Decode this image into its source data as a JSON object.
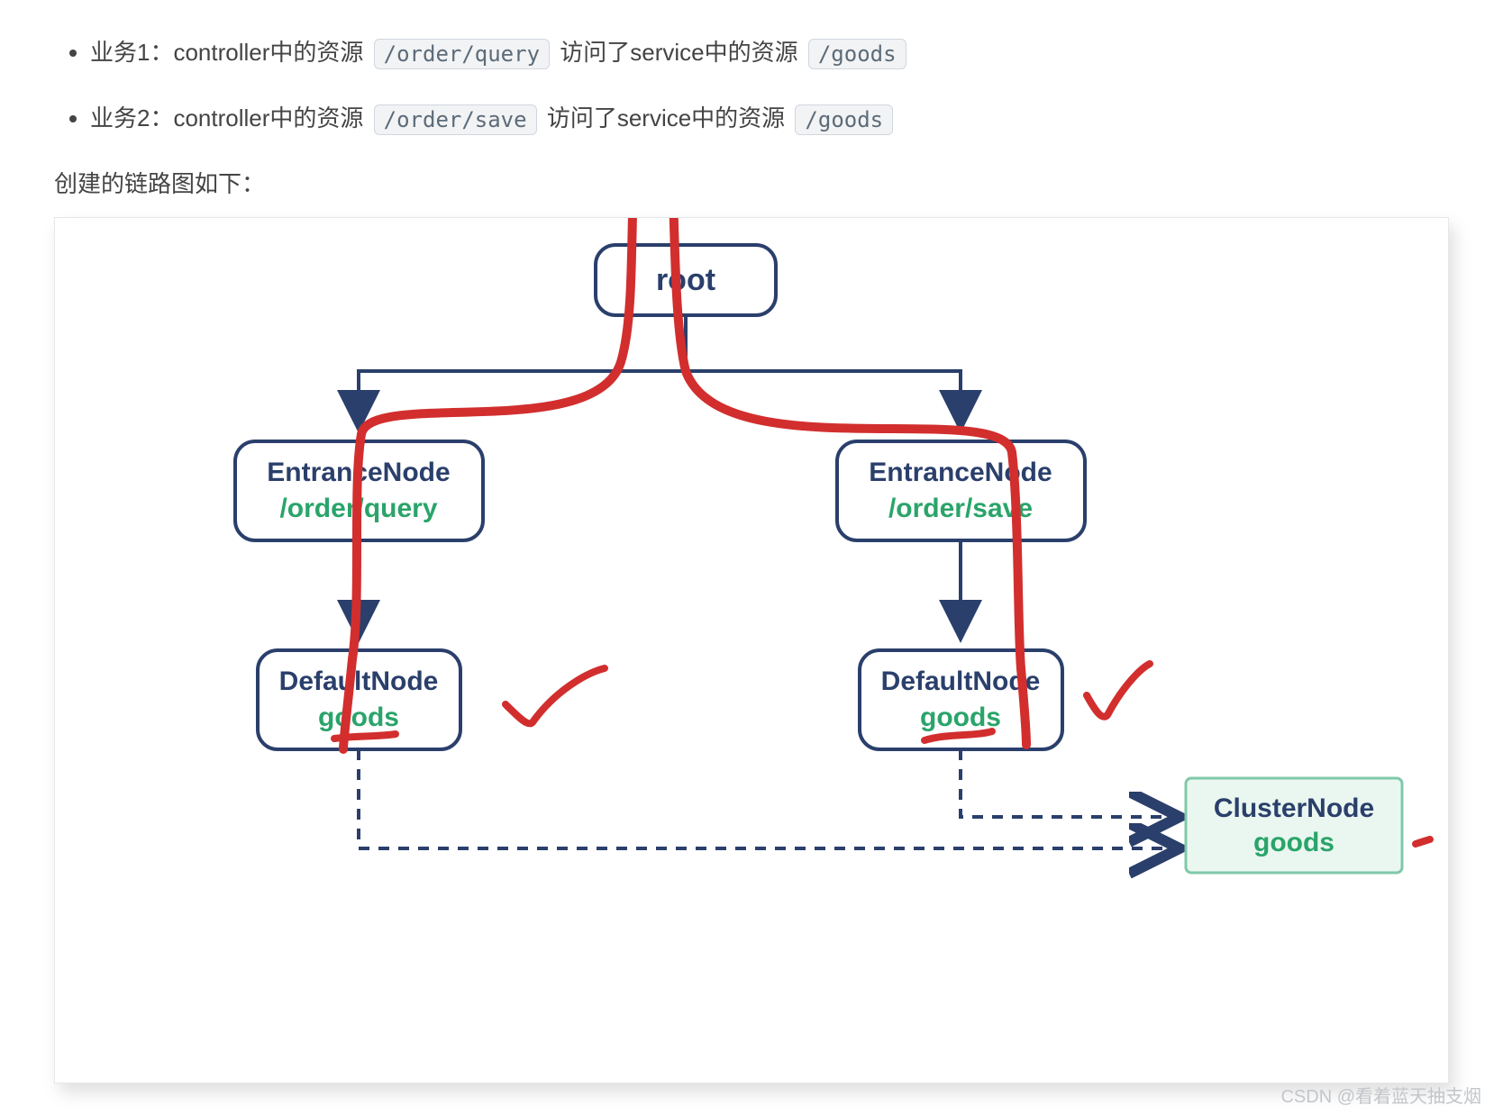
{
  "bullets": [
    {
      "prefix": "业务1：controller中的资源",
      "code1": "/order/query",
      "mid": "访问了service中的资源",
      "code2": "/goods"
    },
    {
      "prefix": "业务2：controller中的资源",
      "code1": "/order/save",
      "mid": "访问了service中的资源",
      "code2": "/goods"
    }
  ],
  "para": "创建的链路图如下：",
  "diagram": {
    "root": "root",
    "entranceLeft": {
      "title": "EntranceNode",
      "path": "/order/query"
    },
    "entranceRight": {
      "title": "EntranceNode",
      "path": "/order/save"
    },
    "defaultLeft": {
      "title": "DefaultNode",
      "res": "goods"
    },
    "defaultRight": {
      "title": "DefaultNode",
      "res": "goods"
    },
    "cluster": {
      "title": "ClusterNode",
      "res": "goods"
    }
  },
  "watermark": "CSDN @看着蓝天抽支烟"
}
